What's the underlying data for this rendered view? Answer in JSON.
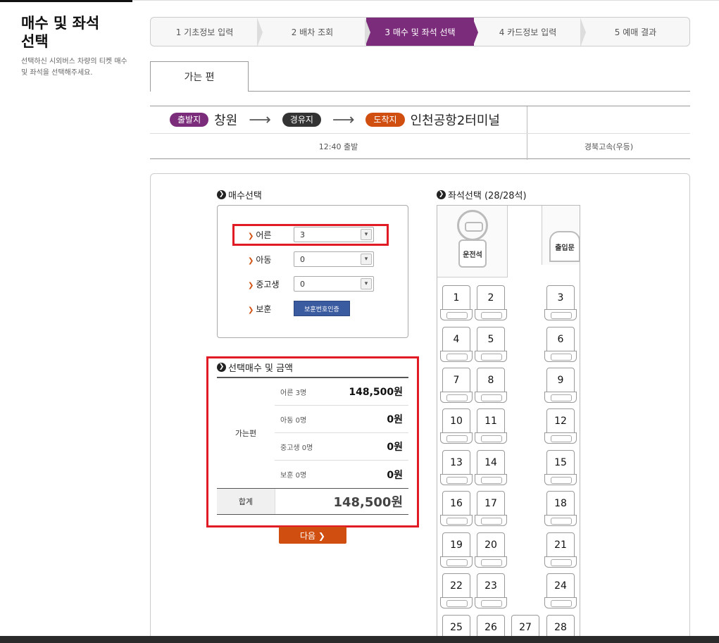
{
  "sidebar": {
    "title_line1": "매수 및 좌석",
    "title_line2": "선택",
    "description": "선택하신 시외버스 차량의 티켓 매수 및 좌석을 선택해주세요."
  },
  "steps": [
    {
      "label": "1 기초정보 입력",
      "active": false
    },
    {
      "label": "2 배차 조회",
      "active": false
    },
    {
      "label": "3 매수 및 좌석 선택",
      "active": true
    },
    {
      "label": "4 카드정보 입력",
      "active": false
    },
    {
      "label": "5 예매 결과",
      "active": false
    }
  ],
  "tab": {
    "label": "가는 편"
  },
  "route": {
    "departure_badge": "출발지",
    "departure": "창원",
    "via_badge": "경유지",
    "arrival_badge": "도착지",
    "arrival": "인천공항2터미널",
    "arrow": "⟶",
    "time": "12:40 출발",
    "company": "경북고속(우등)",
    "colors": {
      "departure": "#7b2d7b",
      "via": "#333333",
      "arrival": "#d04e0f"
    }
  },
  "quantity": {
    "title": "매수선택",
    "rows": [
      {
        "label": "어른",
        "value": "3"
      },
      {
        "label": "아동",
        "value": "0"
      },
      {
        "label": "중고생",
        "value": "0"
      }
    ],
    "veteran_label": "보훈",
    "veteran_button": "보훈번호인증"
  },
  "summary": {
    "title": "선택매수 및 금액",
    "direction": "가는편",
    "rows": [
      {
        "label": "어른 3명",
        "amount": "148,500원"
      },
      {
        "label": "아동 0명",
        "amount": "0원"
      },
      {
        "label": "중고생 0명",
        "amount": "0원"
      },
      {
        "label": "보훈 0명",
        "amount": "0원"
      }
    ],
    "total_label": "합계",
    "total_amount": "148,500원"
  },
  "next_button": "다음 ❯",
  "seat_map": {
    "title": "좌석선택 (28/28석)",
    "driver_label": "운전석",
    "door_label": "출입문",
    "seats": [
      "1",
      "2",
      "3",
      "4",
      "5",
      "6",
      "7",
      "8",
      "9",
      "10",
      "11",
      "12",
      "13",
      "14",
      "15",
      "16",
      "17",
      "18",
      "19",
      "20",
      "21",
      "22",
      "23",
      "24",
      "25",
      "26",
      "27",
      "28"
    ]
  },
  "accent_color": "#7b2d7b",
  "highlight_color": "#e01b24"
}
